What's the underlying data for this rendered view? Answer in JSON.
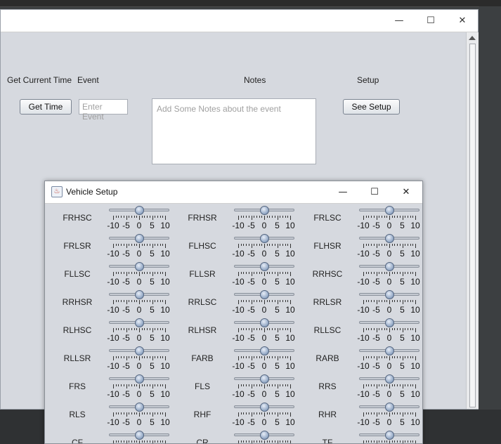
{
  "main_window": {
    "caption": {
      "minimize": "—",
      "maximize": "☐",
      "close": "✕"
    },
    "labels": {
      "get_current_time": "Get Current Time",
      "event": "Event",
      "notes": "Notes",
      "setup": "Setup"
    },
    "get_time_button": "Get Time",
    "event_input": {
      "placeholder": "Enter Event",
      "value": ""
    },
    "notes_area": {
      "placeholder": "Add Some Notes about the event",
      "value": ""
    },
    "see_setup_button": "See Setup"
  },
  "dialog": {
    "title": "Vehicle Setup",
    "icon": "java-cup-icon",
    "caption": {
      "minimize": "—",
      "maximize": "☐",
      "close": "✕"
    },
    "slider_scale": {
      "min": -10,
      "max": 10,
      "labels": [
        "-10",
        "-5",
        "0",
        "5",
        "10"
      ]
    },
    "sliders": [
      {
        "name": "FRHSC",
        "value": 0
      },
      {
        "name": "FRHSR",
        "value": 0
      },
      {
        "name": "FRLSC",
        "value": 0
      },
      {
        "name": "FRLSR",
        "value": 0
      },
      {
        "name": "FLHSC",
        "value": 0
      },
      {
        "name": "FLHSR",
        "value": 0
      },
      {
        "name": "FLLSC",
        "value": 0
      },
      {
        "name": "FLLSR",
        "value": 0
      },
      {
        "name": "RRHSC",
        "value": 0
      },
      {
        "name": "RRHSR",
        "value": 0
      },
      {
        "name": "RRLSC",
        "value": 0
      },
      {
        "name": "RRLSR",
        "value": 0
      },
      {
        "name": "RLHSC",
        "value": 0
      },
      {
        "name": "RLHSR",
        "value": 0
      },
      {
        "name": "RLLSC",
        "value": 0
      },
      {
        "name": "RLLSR",
        "value": 0
      },
      {
        "name": "FARB",
        "value": 0
      },
      {
        "name": "RARB",
        "value": 0
      },
      {
        "name": "FRS",
        "value": 0
      },
      {
        "name": "FLS",
        "value": 0
      },
      {
        "name": "RRS",
        "value": 0
      },
      {
        "name": "RLS",
        "value": 0
      },
      {
        "name": "RHF",
        "value": 0
      },
      {
        "name": "RHR",
        "value": 0
      },
      {
        "name": "CF",
        "value": 0
      },
      {
        "name": "CR",
        "value": 0
      },
      {
        "name": "TF",
        "value": 0
      }
    ]
  }
}
